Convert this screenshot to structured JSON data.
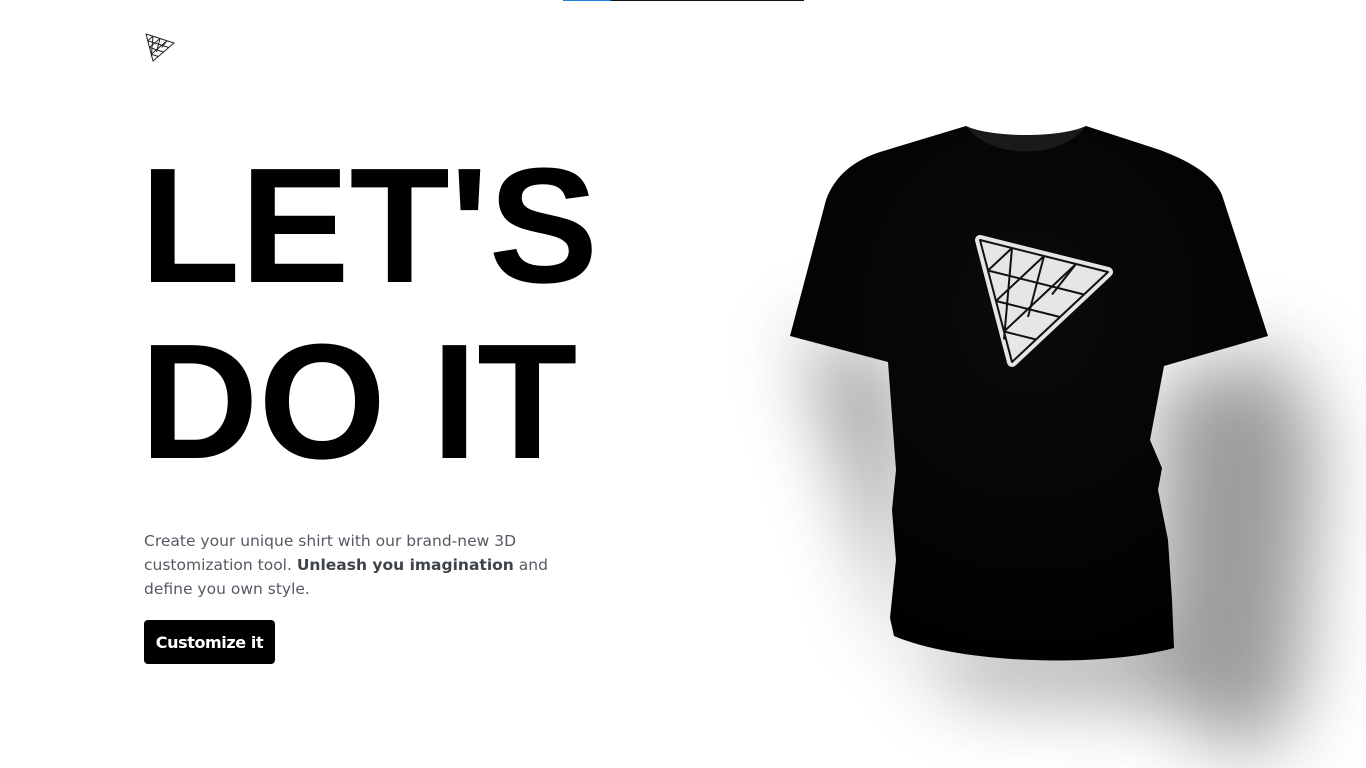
{
  "loader": {
    "progress": 0.2
  },
  "logo": {
    "icon": "triangle-mesh-logo-icon"
  },
  "hero": {
    "headline_line1": "LET'S",
    "headline_line2": "DO IT",
    "intro_part1": "Create your unique shirt with our brand-new 3D customization tool. ",
    "intro_bold": "Unleash you imagination",
    "intro_part2": " and define you own style.",
    "cta_label": "Customize it"
  },
  "shirt": {
    "color": "#000000",
    "decal_icon": "triangle-mesh-decal-icon",
    "decal_fill": "#e6e6e6"
  },
  "colors": {
    "accent": "#1f7ae0",
    "text_primary": "#000000",
    "text_secondary": "#555a62",
    "button_bg": "#000000",
    "button_text": "#ffffff"
  }
}
